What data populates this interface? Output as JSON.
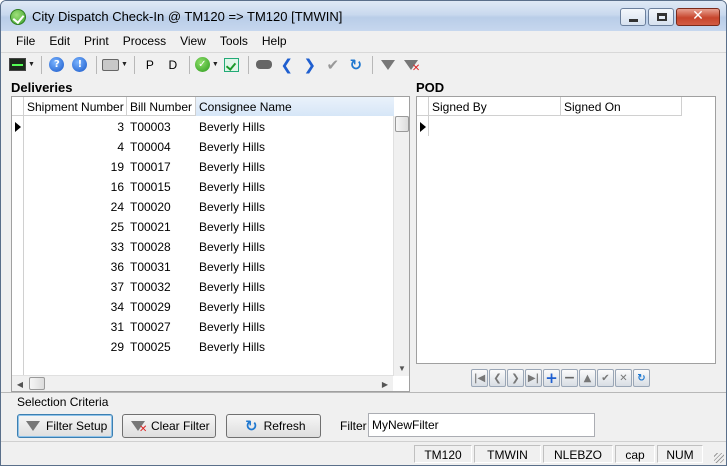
{
  "window": {
    "title": "City Dispatch Check-In @ TM120 => TM120 [TMWIN]"
  },
  "menu": [
    "File",
    "Edit",
    "Print",
    "Process",
    "View",
    "Tools",
    "Help"
  ],
  "toolbar": {
    "p_label": "P",
    "d_label": "D"
  },
  "deliveries": {
    "title": "Deliveries",
    "columns": [
      "Shipment Number",
      "Bill Number",
      "Consignee Name"
    ],
    "rows": [
      [
        "3",
        "T00003",
        "Beverly Hills"
      ],
      [
        "4",
        "T00004",
        "Beverly Hills"
      ],
      [
        "19",
        "T00017",
        "Beverly Hills"
      ],
      [
        "16",
        "T00015",
        "Beverly Hills"
      ],
      [
        "24",
        "T00020",
        "Beverly Hills"
      ],
      [
        "25",
        "T00021",
        "Beverly Hills"
      ],
      [
        "33",
        "T00028",
        "Beverly Hills"
      ],
      [
        "36",
        "T00031",
        "Beverly Hills"
      ],
      [
        "37",
        "T00032",
        "Beverly Hills"
      ],
      [
        "34",
        "T00029",
        "Beverly Hills"
      ],
      [
        "31",
        "T00027",
        "Beverly Hills"
      ],
      [
        "29",
        "T00025",
        "Beverly Hills"
      ]
    ]
  },
  "pod": {
    "title": "POD",
    "columns": [
      "Signed By",
      "Signed On"
    ]
  },
  "selection": {
    "title": "Selection Criteria",
    "filter_setup": "Filter Setup",
    "clear_filter": "Clear Filter",
    "refresh": "Refresh",
    "filter_label": "Filter",
    "filter_value": "MyNewFilter"
  },
  "status": [
    "TM120",
    "TMWIN",
    "NLEBZO",
    "cap",
    "NUM"
  ]
}
